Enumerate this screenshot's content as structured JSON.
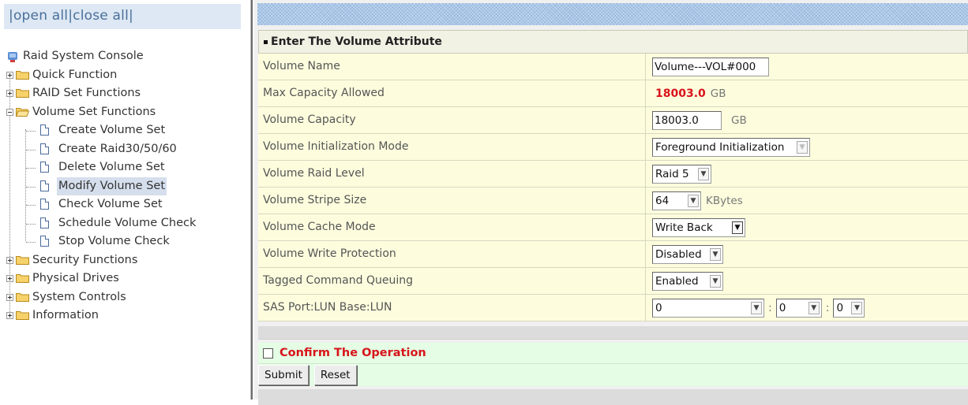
{
  "tree": {
    "open_all": "open all",
    "close_all": "close all",
    "root": "Raid System Console",
    "nodes": {
      "quick": "Quick Function",
      "raid": "RAID Set Functions",
      "volume": "Volume Set Functions",
      "create_volume": "Create Volume Set",
      "create_raid": "Create Raid30/50/60",
      "delete_volume": "Delete Volume Set",
      "modify_volume": "Modify Volume Set",
      "check_volume": "Check Volume Set",
      "schedule_check": "Schedule Volume Check",
      "stop_check": "Stop Volume Check",
      "security": "Security Functions",
      "physical": "Physical Drives",
      "system": "System Controls",
      "information": "Information"
    }
  },
  "form": {
    "header": "Enter The Volume Attribute",
    "labels": {
      "name": "Volume Name",
      "max_capacity": "Max Capacity Allowed",
      "capacity": "Volume Capacity",
      "init_mode": "Volume Initialization Mode",
      "raid_level": "Volume Raid Level",
      "stripe_size": "Volume Stripe Size",
      "cache_mode": "Volume Cache Mode",
      "write_protection": "Volume Write Protection",
      "tcq": "Tagged Command Queuing",
      "sas_port": "SAS Port:LUN Base:LUN"
    },
    "values": {
      "name": "Volume---VOL#000",
      "max_capacity": "18003.0",
      "max_capacity_unit": "GB",
      "capacity": "18003.0",
      "capacity_unit": "GB",
      "init_mode": "Foreground Initialization",
      "raid_level": "Raid 5",
      "stripe_size": "64",
      "stripe_unit": "KBytes",
      "cache_mode": "Write Back",
      "write_protection": "Disabled",
      "tcq": "Enabled",
      "sas_port": "0",
      "lun_base": "0",
      "lun": "0",
      "colon": ":"
    },
    "confirm_label": "Confirm The Operation",
    "submit": "Submit",
    "reset": "Reset"
  },
  "colors": {
    "accent_red": "#d8141b",
    "tree_header": "#dde8f4"
  }
}
